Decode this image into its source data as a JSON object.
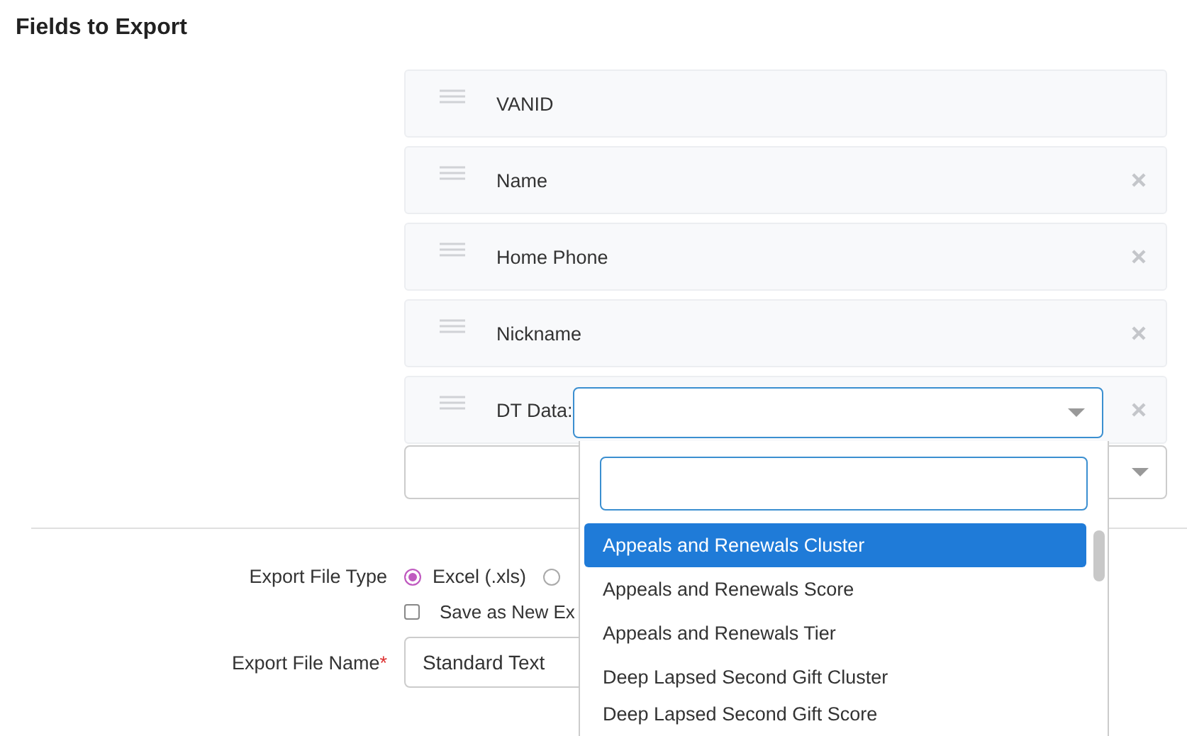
{
  "section_title": "Fields to Export",
  "fields": [
    {
      "label": "VANID",
      "removable": false,
      "kind": "text"
    },
    {
      "label": "Name",
      "removable": true,
      "kind": "text"
    },
    {
      "label": "Home Phone",
      "removable": true,
      "kind": "text"
    },
    {
      "label": "Nickname",
      "removable": true,
      "kind": "text"
    },
    {
      "label": "DT Data:",
      "removable": true,
      "kind": "select"
    }
  ],
  "dropdown": {
    "options": [
      {
        "label": "Appeals and Renewals Cluster",
        "selected": true
      },
      {
        "label": "Appeals and Renewals Score",
        "selected": false
      },
      {
        "label": "Appeals and Renewals Tier",
        "selected": false
      },
      {
        "label": "Deep Lapsed Second Gift Cluster",
        "selected": false
      },
      {
        "label": "Deep Lapsed Second Gift Score",
        "selected": false
      }
    ]
  },
  "export_file_type": {
    "label": "Export File Type",
    "options": [
      {
        "label": "Excel (.xls)",
        "selected": true
      },
      {
        "selected": false
      }
    ]
  },
  "save_as_new": {
    "label": "Save as New Ex",
    "checked": false
  },
  "export_file_name": {
    "label": "Export File Name",
    "required_mark": "*",
    "value": "Standard Text"
  }
}
